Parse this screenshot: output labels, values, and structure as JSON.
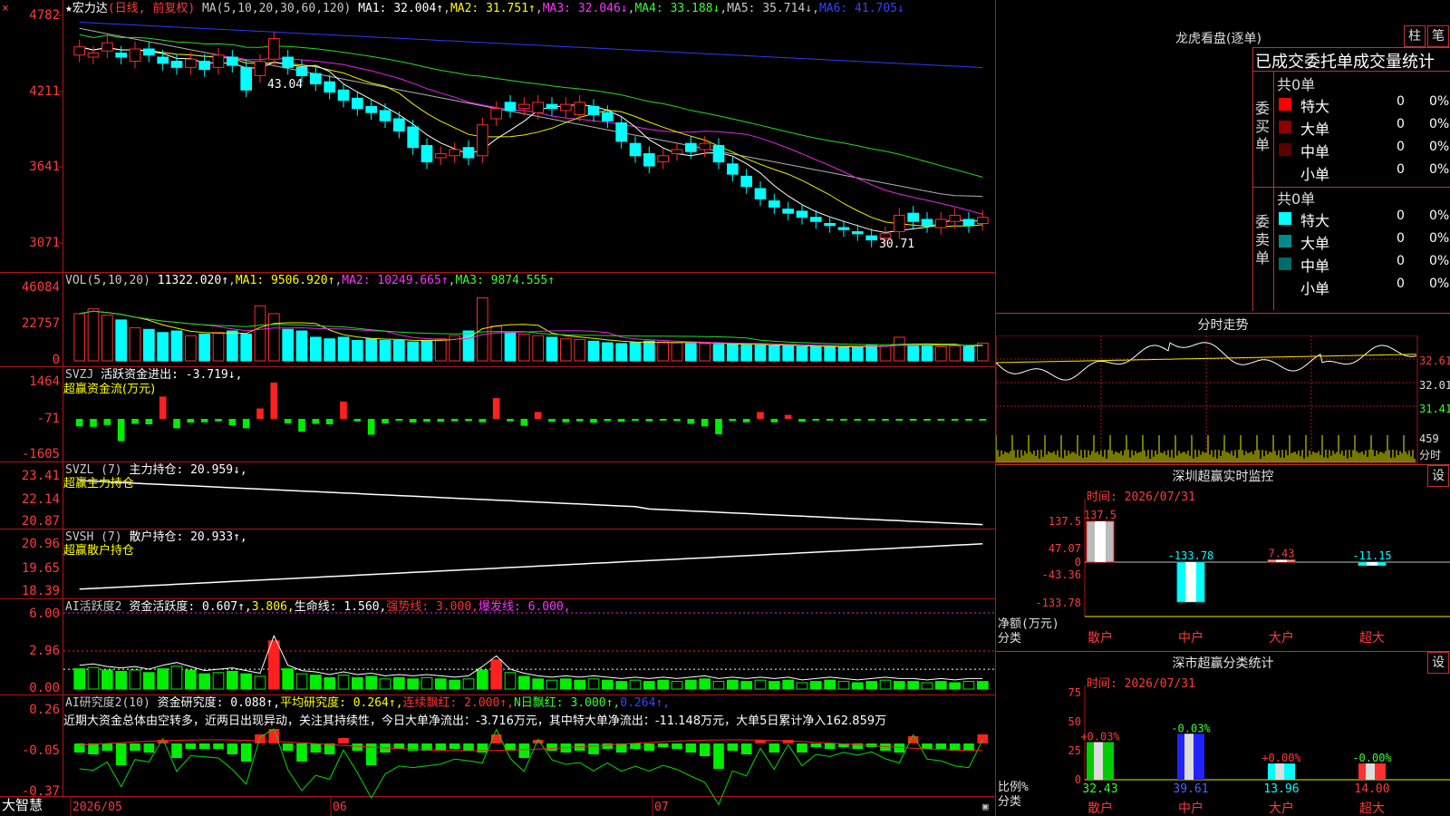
{
  "stock": {
    "star": "★",
    "name": "宏力达",
    "period": "(日线, 前复权)"
  },
  "ma_line": {
    "label": "MA(5,10,20,30,60,120)",
    "items": [
      {
        "text": "MA1: 32.004↑",
        "color": "#ffffff"
      },
      {
        "text": "MA2: 31.751↑",
        "color": "#ffff00"
      },
      {
        "text": "MA3: 32.046↓",
        "color": "#ff33ff"
      },
      {
        "text": "MA4: 33.188↓",
        "color": "#33ff33"
      },
      {
        "text": "MA5: 35.714↓",
        "color": "#c8c8c8"
      },
      {
        "text": "MA6: 41.705↓",
        "color": "#3344ff"
      }
    ]
  },
  "price_axis": [
    "4782",
    "4211",
    "3641",
    "3071"
  ],
  "annotations": {
    "high": "43.04",
    "low": "30.71"
  },
  "vol_panel": {
    "title": "VOL(5,10,20)",
    "value": "11322.020↑",
    "ma1": "MA1: 9506.920↑",
    "ma2": "MA2: 10249.665↑",
    "ma3": "MA3: 9874.555↑",
    "axis": [
      "46084",
      "22757",
      "0"
    ]
  },
  "svzj_panel": {
    "title": "SVZJ",
    "text": "活跃资金进出: -3.719↓,",
    "sub": "超赢资金流(万元)",
    "axis": [
      "1464",
      "-71",
      "-1605"
    ]
  },
  "svzl_panel": {
    "title": "SVZL (7)",
    "text": "主力持仓: 20.959↓,",
    "sub": "超赢主力持仓",
    "axis": [
      "23.41",
      "22.14",
      "20.87"
    ]
  },
  "svsh_panel": {
    "title": "SVSH (7)",
    "text": "散户持仓: 20.933↑,",
    "sub": "超赢散户持仓",
    "axis": [
      "20.96",
      "19.65",
      "18.39"
    ]
  },
  "ai_active_panel": {
    "title": "AI活跃度2",
    "t1": "资金活跃度: 0.607↑,",
    "t2": "3.806,",
    "t3": "生命线: 1.560,",
    "t4": "强势线: 3.000,",
    "t5": "爆发线: 6.000,",
    "axis": [
      "6.00",
      "2.96",
      "0.00"
    ]
  },
  "ai_research_panel": {
    "title": "AI研究度2(10)",
    "t1": "资金研究度: 0.088↑,",
    "t2": "平均研究度: 0.264↑,",
    "t3": "连续飘红: 2.000↑,",
    "t4": "N日飘红: 3.000↑,",
    "t5": "0.264↑,",
    "axis": [
      "0.26",
      "-0.05",
      "-0.37"
    ],
    "comment": "近期大资金总体由空转多，近两日出现异动，关注其持续性，今日大单净流出：-3.716万元，其中特大单净流出：-11.148万元，大单5日累计净入162.859万"
  },
  "time_axis": {
    "brand": "大智慧",
    "d1": "2026/05",
    "d2": "06",
    "d3": "07"
  },
  "right": {
    "dragon_title": "龙虎看盘(逐单)",
    "btn_a": "柱",
    "btn_b": "笔",
    "tabs_text": "已成交委托单成交量统计",
    "buy": {
      "side": "委买单",
      "total": "共0单",
      "rows": [
        {
          "label": "特大",
          "count": "0",
          "pct": "0%",
          "color": "#ff0000"
        },
        {
          "label": "大单",
          "count": "0",
          "pct": "0%",
          "color": "#8b0000"
        },
        {
          "label": "中单",
          "count": "0",
          "pct": "0%",
          "color": "#5a0000"
        },
        {
          "label": "小单",
          "count": "0",
          "pct": "0%",
          "color": "#000000"
        }
      ]
    },
    "sell": {
      "side": "委卖单",
      "total": "共0单",
      "rows": [
        {
          "label": "特大",
          "count": "0",
          "pct": "0%",
          "color": "#00ffff"
        },
        {
          "label": "大单",
          "count": "0",
          "pct": "0%",
          "color": "#008b8b"
        },
        {
          "label": "中单",
          "count": "0",
          "pct": "0%",
          "color": "#006b6b"
        },
        {
          "label": "小单",
          "count": "0",
          "pct": "0%",
          "color": "#000000"
        }
      ]
    },
    "intraday": {
      "title": "分时走势",
      "p1": "32.61",
      "p2": "32.01",
      "p3": "31.41",
      "v": "459",
      "unit": "分时"
    },
    "monitor": {
      "title": "深圳超赢实时监控",
      "btn": "设",
      "time": "时间: 2026/07/31",
      "axis": [
        "137.5",
        "47.07",
        "0",
        "-43.36",
        "-133.78"
      ],
      "unit_a": "净额(万元)",
      "unit_b": "分类",
      "bars": [
        {
          "cat": "散户",
          "value": 137.5,
          "label": "137.5"
        },
        {
          "cat": "中户",
          "value": -133.78,
          "label": "-133.78"
        },
        {
          "cat": "大户",
          "value": 7.43,
          "label": "7.43"
        },
        {
          "cat": "超大",
          "value": -11.15,
          "label": "-11.15"
        }
      ]
    },
    "classify": {
      "title": "深市超赢分类统计",
      "btn": "设",
      "time": "时间: 2026/07/31",
      "axis": [
        "75",
        "50",
        "25",
        "0"
      ],
      "unit_a": "比例%",
      "unit_b": "分类",
      "bars": [
        {
          "cat": "散户",
          "value": 32.43,
          "label": "32.43",
          "chg": "+0.03%"
        },
        {
          "cat": "中户",
          "value": 39.61,
          "label": "39.61",
          "chg": "-0.03%"
        },
        {
          "cat": "大户",
          "value": 13.96,
          "label": "13.96",
          "chg": "+0.00%"
        },
        {
          "cat": "超大",
          "value": 14.0,
          "label": "14.00",
          "chg": "-0.00%"
        }
      ]
    }
  },
  "series": {
    "close": [
      40.6,
      40.3,
      40.8,
      40.1,
      40.5,
      40.2,
      39.8,
      39.6,
      40.0,
      39.5,
      40.2,
      39.7,
      38.5,
      39.9,
      41.0,
      39.6,
      39.2,
      38.8,
      38.4,
      38.0,
      37.6,
      37.4,
      37.0,
      36.5,
      35.7,
      35.0,
      35.4,
      35.6,
      35.2,
      36.8,
      37.6,
      37.5,
      37.8,
      37.9,
      37.6,
      37.8,
      37.9,
      37.3,
      37.0,
      36.0,
      35.3,
      34.8,
      35.3,
      35.6,
      35.5,
      35.9,
      35.0,
      34.4,
      33.8,
      33.2,
      32.8,
      32.5,
      32.3,
      32.1,
      31.9,
      31.7,
      31.5,
      31.2,
      31.5,
      32.4,
      32.1,
      31.9,
      32.2,
      32.4,
      31.9,
      32.3
    ],
    "open": [
      40.2,
      40.1,
      40.4,
      40.3,
      39.9,
      40.5,
      40.1,
      39.9,
      39.6,
      39.9,
      39.6,
      40.1,
      39.6,
      39.2,
      40.0,
      40.1,
      39.6,
      39.3,
      38.9,
      38.5,
      38.1,
      37.7,
      37.5,
      37.1,
      36.7,
      35.8,
      35.2,
      35.3,
      35.7,
      35.3,
      37.1,
      37.9,
      37.6,
      37.4,
      37.8,
      37.5,
      37.3,
      37.7,
      37.4,
      36.9,
      35.9,
      35.4,
      35.0,
      35.4,
      35.9,
      35.6,
      35.8,
      34.9,
      34.3,
      33.7,
      33.1,
      32.7,
      32.6,
      32.3,
      32.0,
      31.8,
      31.6,
      31.4,
      31.3,
      31.6,
      32.5,
      32.2,
      31.8,
      32.1,
      32.2,
      32.0
    ],
    "volume": [
      30000,
      33000,
      29000,
      26000,
      21000,
      20000,
      18000,
      19000,
      16000,
      17000,
      18000,
      19000,
      17000,
      35000,
      30000,
      20000,
      19000,
      15000,
      14000,
      15000,
      13000,
      14000,
      13000,
      13000,
      12000,
      13000,
      14000,
      16000,
      19000,
      40000,
      22000,
      18000,
      17000,
      16000,
      15000,
      14000,
      13500,
      12500,
      11500,
      11000,
      11500,
      12500,
      12000,
      11500,
      11000,
      11000,
      10500,
      10500,
      10000,
      10000,
      9500,
      9500,
      9000,
      9000,
      9000,
      8500,
      9000,
      10000,
      9500,
      15000,
      10000,
      9500,
      9000,
      9500,
      9000,
      11300
    ],
    "fund": [
      -300,
      -320,
      -250,
      -900,
      -200,
      -220,
      900,
      -380,
      -150,
      -140,
      -100,
      -260,
      -380,
      420,
      1464,
      -180,
      -520,
      -200,
      -220,
      700,
      -100,
      -640,
      -180,
      -80,
      -150,
      -120,
      -120,
      -100,
      -90,
      -140,
      840,
      -100,
      -280,
      280,
      -120,
      -140,
      -100,
      -160,
      -90,
      -120,
      -80,
      -100,
      -60,
      -90,
      -200,
      -300,
      -620,
      -90,
      -140,
      280,
      -140,
      160,
      -120,
      -40,
      -60,
      -40,
      -60,
      -40,
      -60,
      -40,
      -60,
      -40,
      -60,
      -40,
      -60,
      -40,
      80,
      -40,
      -60,
      80,
      -80,
      120,
      -100,
      -60,
      -80
    ],
    "active": [
      1.6,
      1.7,
      1.5,
      1.4,
      1.5,
      1.3,
      1.6,
      1.8,
      1.5,
      1.2,
      1.3,
      1.4,
      1.2,
      1.0,
      3.8,
      1.6,
      1.2,
      1.1,
      0.9,
      1.1,
      0.9,
      1.0,
      0.8,
      0.9,
      0.8,
      0.9,
      0.8,
      0.7,
      0.8,
      1.5,
      2.3,
      1.3,
      1.0,
      0.8,
      0.7,
      0.8,
      0.7,
      0.8,
      0.7,
      0.6,
      0.7,
      0.6,
      0.7,
      0.6,
      0.7,
      0.8,
      0.6,
      0.7,
      0.6,
      0.7,
      0.6,
      0.7,
      0.5,
      0.6,
      0.7,
      0.6,
      0.5,
      0.6,
      0.7,
      0.6,
      0.6,
      0.5,
      0.6,
      0.5,
      0.6,
      0.6
    ],
    "research": [
      -0.05,
      -0.06,
      -0.04,
      -0.12,
      -0.04,
      -0.05,
      0.02,
      -0.08,
      -0.03,
      -0.03,
      -0.03,
      -0.06,
      -0.1,
      0.05,
      0.08,
      -0.04,
      -0.1,
      -0.05,
      -0.06,
      0.03,
      -0.04,
      -0.12,
      -0.05,
      -0.03,
      -0.04,
      -0.04,
      -0.04,
      -0.03,
      -0.04,
      -0.05,
      0.05,
      -0.04,
      -0.08,
      0.02,
      -0.04,
      -0.05,
      -0.04,
      -0.06,
      -0.03,
      -0.05,
      -0.03,
      -0.04,
      -0.02,
      -0.03,
      -0.05,
      -0.07,
      -0.14,
      -0.04,
      -0.06,
      0.02,
      -0.05,
      0.02,
      -0.05,
      -0.02,
      -0.03,
      -0.02,
      -0.03,
      -0.02,
      -0.04,
      -0.05,
      0.04,
      -0.03,
      -0.03,
      -0.04,
      -0.04,
      0.05
    ]
  }
}
